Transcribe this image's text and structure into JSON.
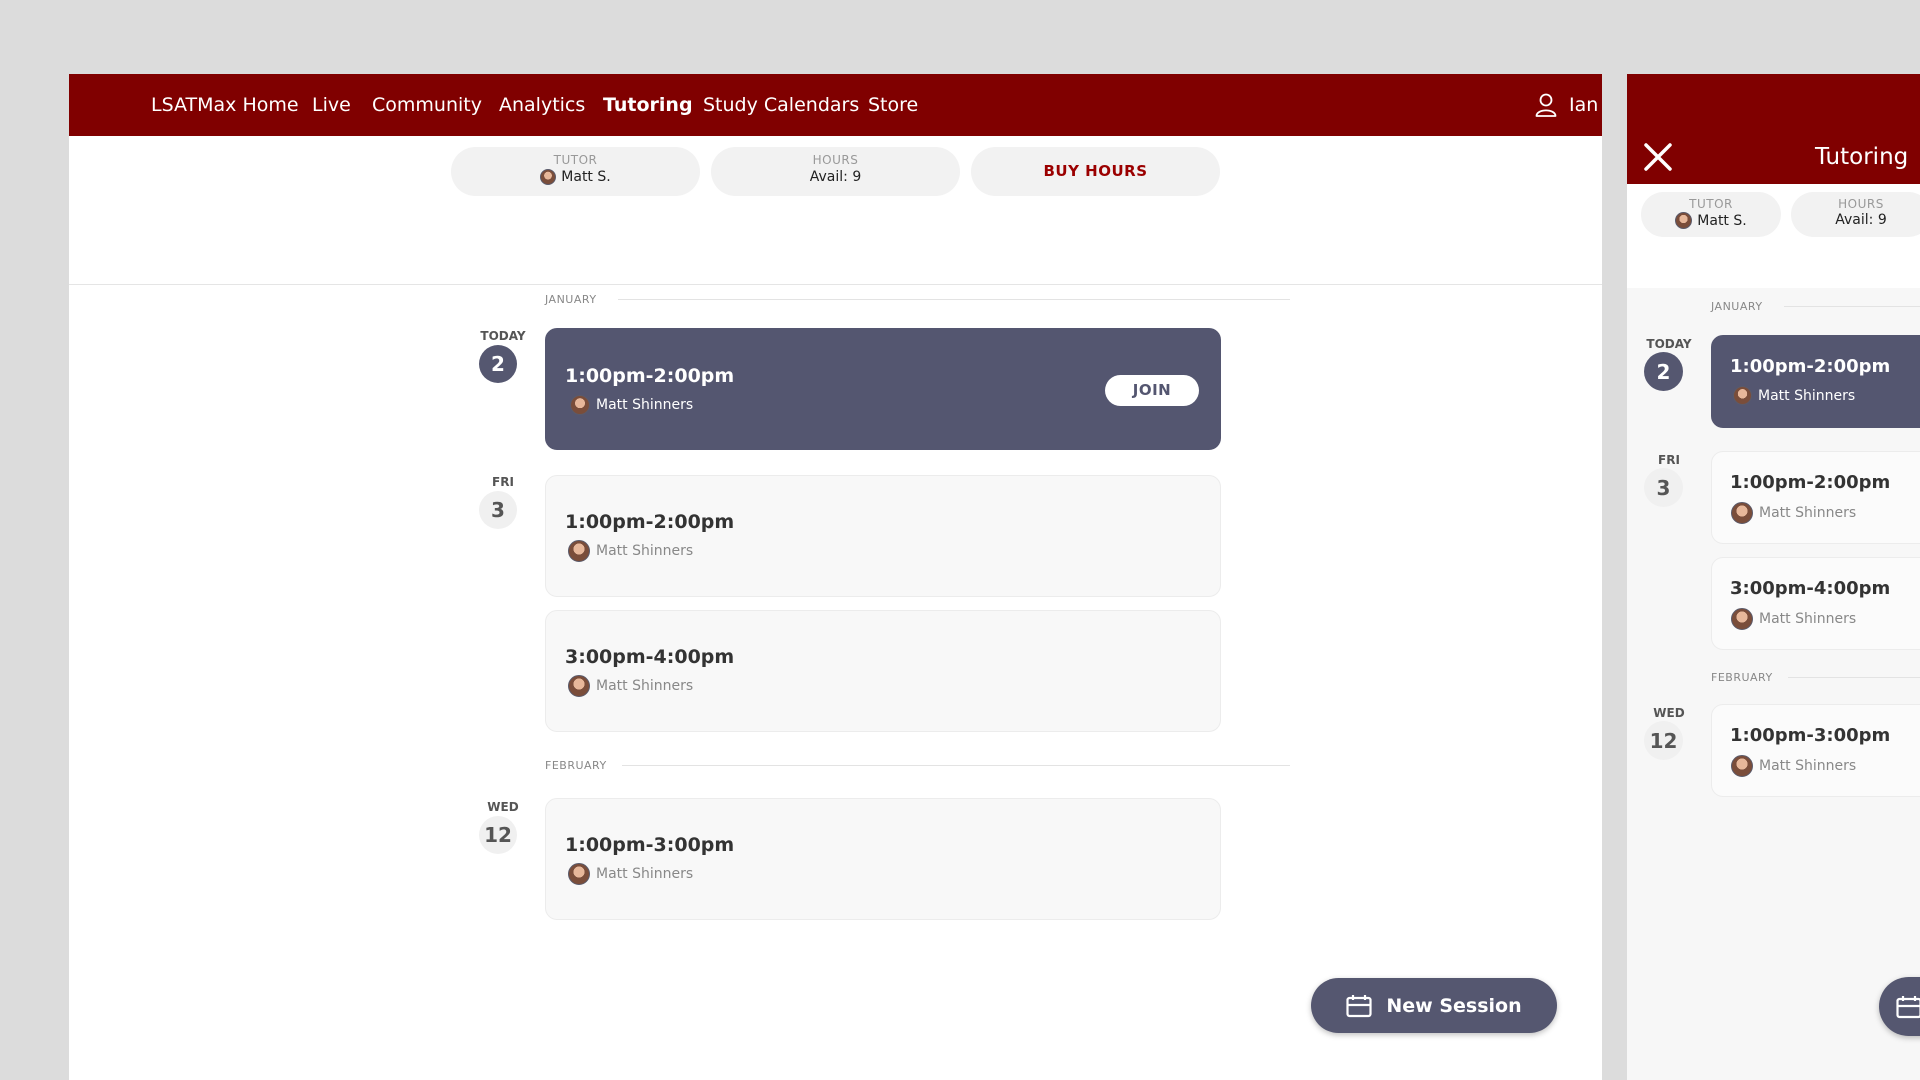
{
  "nav": {
    "items": [
      {
        "label": "LSATMax Home",
        "active": false
      },
      {
        "label": "Live",
        "active": false
      },
      {
        "label": "Community",
        "active": false
      },
      {
        "label": "Analytics",
        "active": false
      },
      {
        "label": "Tutoring",
        "active": true
      },
      {
        "label": "Study Calendars",
        "active": false
      },
      {
        "label": "Store",
        "active": false
      }
    ],
    "user_name": "Ian"
  },
  "summary": {
    "tutor_label": "TUTOR",
    "tutor_value": "Matt S.",
    "hours_label": "HOURS",
    "hours_value": "Avail: 9",
    "buy_label": "BUY HOURS"
  },
  "schedule": {
    "months": [
      "JANUARY",
      "FEBRUARY"
    ],
    "days": [
      {
        "dow": "TODAY",
        "day": "2"
      },
      {
        "dow": "FRI",
        "day": "3"
      },
      {
        "dow": "WED",
        "day": "12"
      }
    ],
    "sessions": [
      {
        "time": "1:00pm-2:00pm",
        "tutor": "Matt Shinners"
      },
      {
        "time": "1:00pm-2:00pm",
        "tutor": "Matt Shinners"
      },
      {
        "time": "3:00pm-4:00pm",
        "tutor": "Matt Shinners"
      },
      {
        "time": "1:00pm-3:00pm",
        "tutor": "Matt Shinners"
      }
    ],
    "join_label": "JOIN"
  },
  "new_session_label": "New Session",
  "mobile": {
    "title": "Tutoring"
  },
  "colors": {
    "brand": "#800000",
    "accent": "#545670"
  }
}
